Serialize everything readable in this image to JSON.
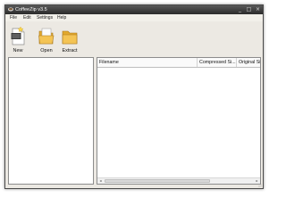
{
  "window": {
    "title": "CoffeeZip v3.5"
  },
  "window_controls": {
    "minimize": "_",
    "maximize": "□",
    "close": "×"
  },
  "menu": {
    "items": [
      "File",
      "Edit",
      "Settings",
      "Help"
    ]
  },
  "toolbar": {
    "buttons": [
      {
        "label": "New",
        "icon": "new-archive-icon"
      },
      {
        "label": "Open",
        "icon": "open-folder-icon"
      },
      {
        "label": "Extract",
        "icon": "extract-folder-icon"
      }
    ]
  },
  "file_list": {
    "columns": [
      "Filename",
      "Compressed Si...",
      "Original Size"
    ]
  },
  "scrollbar": {
    "left_arrow": "◂",
    "right_arrow": "▸"
  },
  "colors": {
    "titlebar": "#2b2b2b",
    "folder": "#f0c24a",
    "pane_background": "#ffffff"
  }
}
